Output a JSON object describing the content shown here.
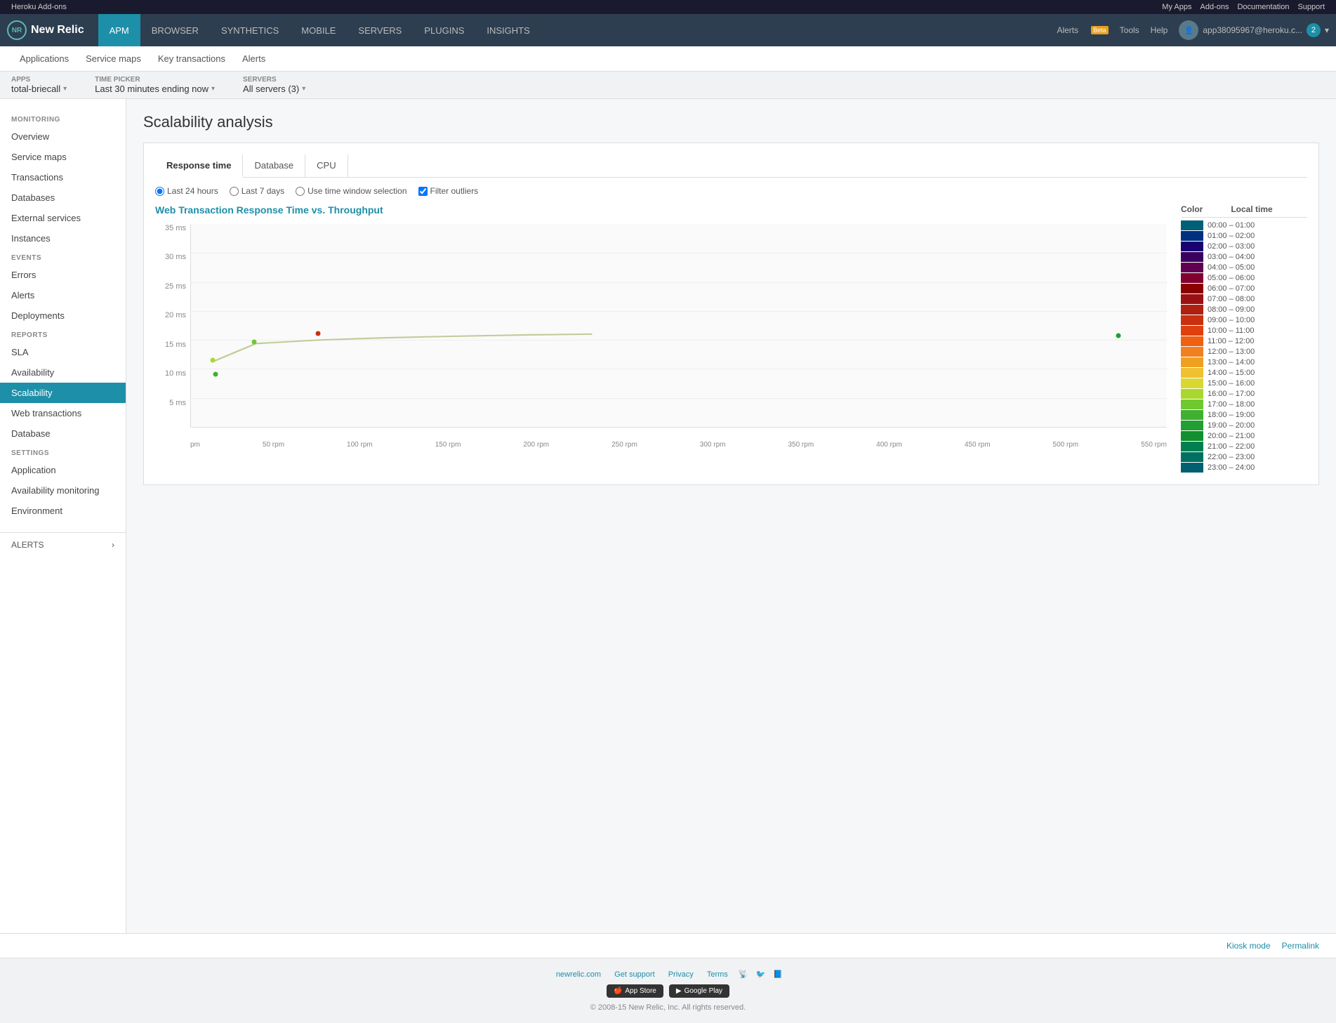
{
  "topBar": {
    "brand": "Heroku Add-ons",
    "links": [
      "My Apps",
      "Add-ons",
      "Documentation",
      "Support"
    ]
  },
  "navBar": {
    "logo": "New Relic",
    "tabs": [
      {
        "label": "APM",
        "active": true
      },
      {
        "label": "BROWSER",
        "active": false
      },
      {
        "label": "SYNTHETICS",
        "active": false
      },
      {
        "label": "MOBILE",
        "active": false
      },
      {
        "label": "SERVERS",
        "active": false
      },
      {
        "label": "PLUGINS",
        "active": false
      },
      {
        "label": "INSIGHTS",
        "active": false
      }
    ],
    "alertsLabel": "Alerts",
    "betaLabel": "Beta",
    "toolsLabel": "Tools",
    "helpLabel": "Help",
    "userEmail": "app38095967@heroku.c...",
    "notifCount": "2"
  },
  "subNav": {
    "links": [
      {
        "label": "Applications",
        "active": false
      },
      {
        "label": "Service maps",
        "active": false
      },
      {
        "label": "Key transactions",
        "active": false
      },
      {
        "label": "Alerts",
        "active": false
      }
    ]
  },
  "appBar": {
    "appsLabel": "APPS",
    "appsValue": "total-briecall",
    "timePickerLabel": "TIME PICKER",
    "timePickerValue": "Last 30 minutes ending now",
    "serversLabel": "SERVERS",
    "serversValue": "All servers (3)"
  },
  "sidebar": {
    "monitoringLabel": "MONITORING",
    "monitoringItems": [
      {
        "label": "Overview",
        "active": false
      },
      {
        "label": "Service maps",
        "active": false
      },
      {
        "label": "Transactions",
        "active": false
      },
      {
        "label": "Databases",
        "active": false
      },
      {
        "label": "External services",
        "active": false
      },
      {
        "label": "Instances",
        "active": false
      }
    ],
    "eventsLabel": "EVENTS",
    "eventsItems": [
      {
        "label": "Errors",
        "active": false
      },
      {
        "label": "Alerts",
        "active": false
      },
      {
        "label": "Deployments",
        "active": false
      }
    ],
    "reportsLabel": "REPORTS",
    "reportsItems": [
      {
        "label": "SLA",
        "active": false
      },
      {
        "label": "Availability",
        "active": false
      },
      {
        "label": "Scalability",
        "active": true
      },
      {
        "label": "Web transactions",
        "active": false
      },
      {
        "label": "Database",
        "active": false
      }
    ],
    "settingsLabel": "SETTINGS",
    "settingsItems": [
      {
        "label": "Application",
        "active": false
      },
      {
        "label": "Availability monitoring",
        "active": false
      },
      {
        "label": "Environment",
        "active": false
      }
    ],
    "alertsLabel": "ALERTS"
  },
  "content": {
    "pageTitle": "Scalability analysis",
    "tabs": [
      {
        "label": "Response time",
        "active": true
      },
      {
        "label": "Database",
        "active": false
      },
      {
        "label": "CPU",
        "active": false
      }
    ],
    "radioOptions": [
      {
        "label": "Last 24 hours",
        "checked": true
      },
      {
        "label": "Last 7 days",
        "checked": false
      },
      {
        "label": "Use time window selection",
        "checked": false
      }
    ],
    "filterLabel": "Filter outliers",
    "filterChecked": true,
    "chartTitle": "Web Transaction Response Time vs.",
    "chartTitleLink": "Throughput",
    "yAxisLabels": [
      "35 ms",
      "30 ms",
      "25 ms",
      "20 ms",
      "15 ms",
      "10 ms",
      "5 ms",
      ""
    ],
    "xAxisLabels": [
      "pm",
      "50 rpm",
      "100 rpm",
      "150 rpm",
      "200 rpm",
      "250 rpm",
      "300 rpm",
      "350 rpm",
      "400 rpm",
      "450 rpm",
      "500 rpm",
      "550 rpm"
    ],
    "legend": {
      "colorHeader": "Color",
      "timeHeader": "Local time",
      "items": [
        {
          "color": "#00607a",
          "label": "00:00 – 01:00"
        },
        {
          "color": "#003080",
          "label": "01:00 – 02:00"
        },
        {
          "color": "#1a0070",
          "label": "02:00 – 03:00"
        },
        {
          "color": "#3a0060",
          "label": "03:00 – 04:00"
        },
        {
          "color": "#600050",
          "label": "04:00 – 05:00"
        },
        {
          "color": "#800030",
          "label": "05:00 – 06:00"
        },
        {
          "color": "#8b0000",
          "label": "06:00 – 07:00"
        },
        {
          "color": "#9b1010",
          "label": "07:00 – 08:00"
        },
        {
          "color": "#b02010",
          "label": "08:00 – 09:00"
        },
        {
          "color": "#c83010",
          "label": "09:00 – 10:00"
        },
        {
          "color": "#e04010",
          "label": "10:00 – 11:00"
        },
        {
          "color": "#f06010",
          "label": "11:00 – 12:00"
        },
        {
          "color": "#f08020",
          "label": "12:00 – 13:00"
        },
        {
          "color": "#f0a020",
          "label": "13:00 – 14:00"
        },
        {
          "color": "#f0c030",
          "label": "14:00 – 15:00"
        },
        {
          "color": "#d8d830",
          "label": "15:00 – 16:00"
        },
        {
          "color": "#a8d830",
          "label": "16:00 – 17:00"
        },
        {
          "color": "#70c830",
          "label": "17:00 – 18:00"
        },
        {
          "color": "#40b030",
          "label": "18:00 – 19:00"
        },
        {
          "color": "#20a030",
          "label": "19:00 – 20:00"
        },
        {
          "color": "#109030",
          "label": "20:00 – 21:00"
        },
        {
          "color": "#008050",
          "label": "21:00 – 22:00"
        },
        {
          "color": "#007060",
          "label": "22:00 – 23:00"
        },
        {
          "color": "#006070",
          "label": "23:00 – 24:00"
        }
      ]
    }
  },
  "footer": {
    "kioskMode": "Kiosk mode",
    "permalink": "Permalink"
  },
  "siteFooter": {
    "links": [
      "newrelic.com",
      "Get support",
      "Privacy",
      "Terms"
    ],
    "appStore": "App Store",
    "googlePlay": "Google Play",
    "copyright": "© 2008-15 New Relic, Inc. All rights reserved."
  }
}
